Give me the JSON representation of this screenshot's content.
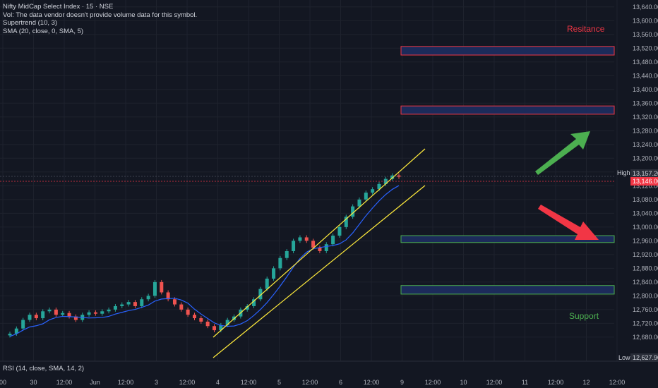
{
  "legend": {
    "title": "Nifty MidCap Select Index · 15 · NSE",
    "vol": "Vol: The data vendor doesn't provide volume data for this symbol.",
    "supertrend": "Supertrend (10, 3)",
    "sma": "SMA (20, close, 0, SMA, 5)"
  },
  "rsi_label": "RSI (14, close, SMA, 14, 2)",
  "annotations": {
    "resistance": "Resitance",
    "support": "Support"
  },
  "chart_data": {
    "type": "candlestick",
    "symbol": "Nifty MidCap Select Index",
    "interval": "15",
    "exchange": "NSE",
    "ylim": [
      12610,
      13660
    ],
    "y_ticks": [
      12680,
      12720,
      12760,
      12800,
      12840,
      12880,
      12920,
      12960,
      13000,
      13040,
      13080,
      13120,
      13160,
      13200,
      13240,
      13280,
      13320,
      13360,
      13400,
      13440,
      13480,
      13520,
      13560,
      13600,
      13640
    ],
    "x_ticks": [
      "00",
      "30",
      "12:00",
      "Jun",
      "12:00",
      "3",
      "12:00",
      "4",
      "12:00",
      "5",
      "12:00",
      "6",
      "12:00",
      "9",
      "12:00",
      "10",
      "12:00",
      "11",
      "12:00",
      "12",
      "12:00"
    ],
    "price_labels": {
      "high_label": "High",
      "high": "13,157.20",
      "current": "13,146.00",
      "low_label": "Low",
      "low": "12,627.90"
    },
    "close_series": [
      12690,
      12705,
      12730,
      12745,
      12735,
      12755,
      12760,
      12745,
      12750,
      12740,
      12730,
      12745,
      12752,
      12748,
      12755,
      12760,
      12770,
      12775,
      12782,
      12770,
      12790,
      12800,
      12840,
      12810,
      12790,
      12775,
      12760,
      12745,
      12735,
      12725,
      12712,
      12700,
      12715,
      12730,
      12740,
      12760,
      12770,
      12790,
      12820,
      12850,
      12880,
      12910,
      12930,
      12960,
      12970,
      12960,
      12940,
      12930,
      12950,
      12975,
      13000,
      13030,
      13060,
      13080,
      13100,
      13110,
      13125,
      13140,
      13150,
      13146
    ],
    "support_zones": [
      [
        12955,
        12975
      ],
      [
        12805,
        12830
      ]
    ],
    "resistance_zones": [
      [
        13500,
        13525
      ],
      [
        13328,
        13352
      ]
    ],
    "colors": {
      "up": "#26a69a",
      "down": "#ef5350",
      "sma": "#2962ff",
      "channel": "#ffeb3b",
      "support": "#4caf50",
      "resistance": "#f23645"
    }
  }
}
